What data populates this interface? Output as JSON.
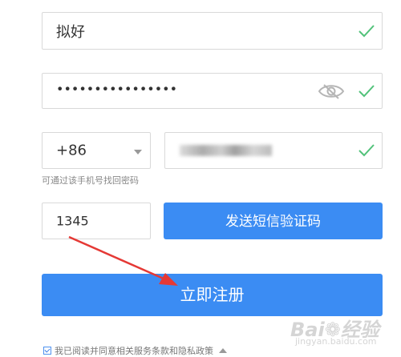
{
  "form": {
    "username_value": "拟好",
    "password_value": "••••••••••••••••",
    "country_code": "+86",
    "phone_hint": "可通过该手机号找回密码",
    "sms_code_value": "1345",
    "send_sms_label": "发送短信验证码",
    "register_label": "立即注册",
    "agreement_text": "我已阅读并同意相关服务条款和隐私政策",
    "agreement_checked": true
  },
  "watermark": {
    "logo_text": "Bai❁经验",
    "sub_text": "jingyan.baidu.com"
  },
  "icons": {
    "valid": "check-icon",
    "password_toggle": "eye-slash-icon",
    "dropdown": "caret-down-icon",
    "collapse": "caret-up-icon"
  },
  "colors": {
    "primary": "#3b8cf3",
    "valid": "#52c27a",
    "annotation_arrow": "#e53935"
  }
}
